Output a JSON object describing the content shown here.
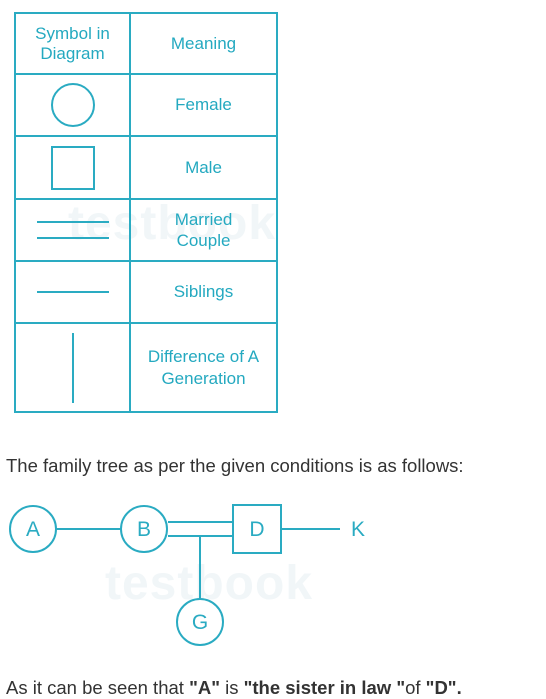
{
  "legend": {
    "header_symbol": "Symbol in Diagram",
    "header_meaning": "Meaning",
    "rows": [
      {
        "symbol": "circle-icon",
        "meaning": "Female"
      },
      {
        "symbol": "square-icon",
        "meaning": "Male"
      },
      {
        "symbol": "double-line-icon",
        "meaning": "Married Couple"
      },
      {
        "symbol": "single-line-icon",
        "meaning": "Siblings"
      },
      {
        "symbol": "vertical-line-icon",
        "meaning": "Difference of A Generation"
      }
    ]
  },
  "explanation": "The family tree as per the given conditions is as follows:",
  "tree": {
    "nodes": {
      "a": "A",
      "b": "B",
      "d": "D",
      "k": "K",
      "g": "G"
    }
  },
  "conclusion": {
    "prefix": "As it can be seen that ",
    "subject": "\"A\"",
    "mid1": " is ",
    "relation": "\"the sister in law \"",
    "mid2": "of ",
    "object": "\"D\"."
  },
  "watermark": "testbook",
  "colors": {
    "accent": "#2aabc2",
    "text": "#333333"
  }
}
